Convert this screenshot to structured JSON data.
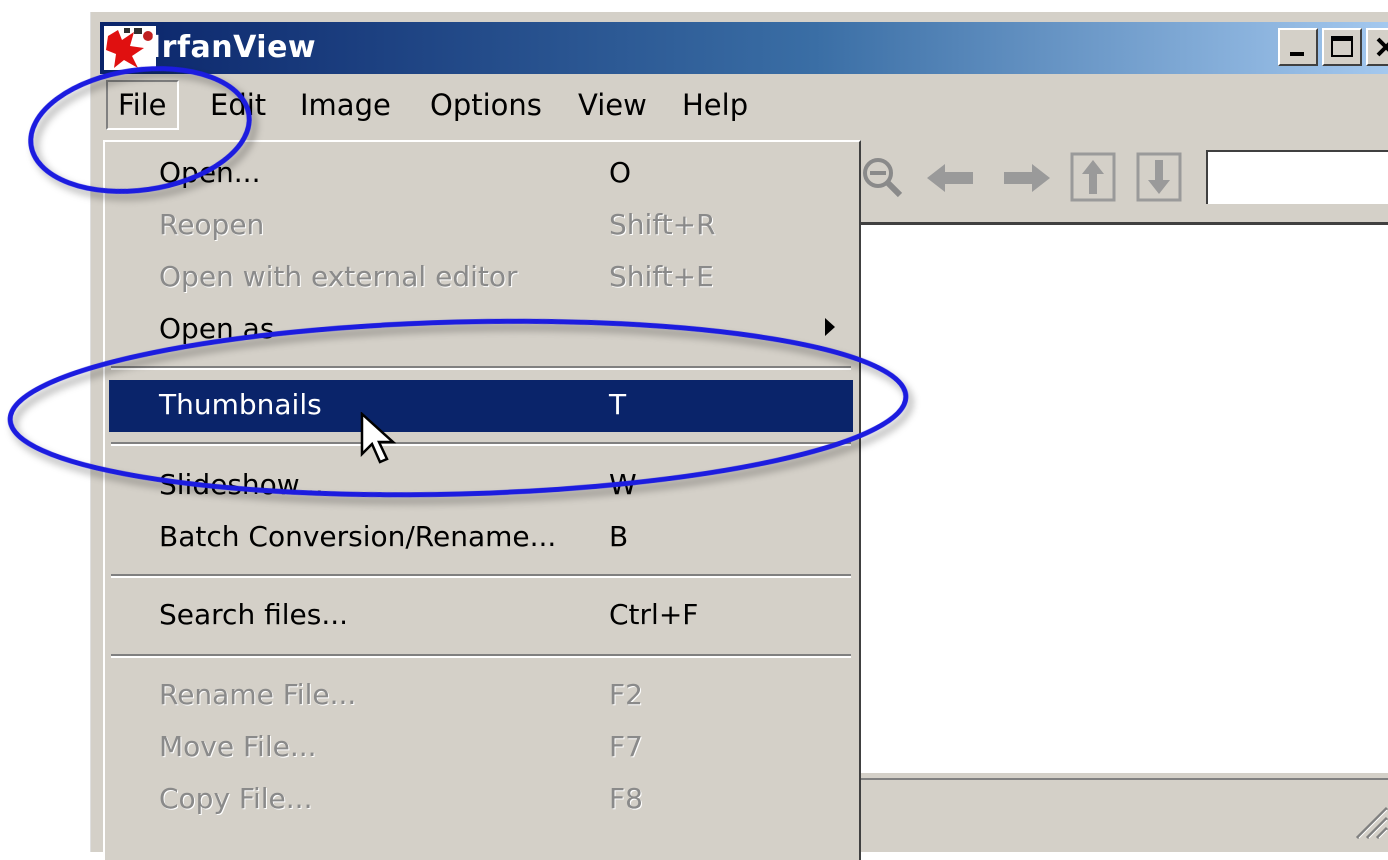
{
  "window": {
    "title": "IrfanView",
    "title_buttons": [
      "minimize",
      "maximize",
      "close"
    ]
  },
  "menubar": {
    "items": [
      "File",
      "Edit",
      "Image",
      "Options",
      "View",
      "Help"
    ]
  },
  "file_menu": {
    "items": [
      {
        "label": "Open...",
        "shortcut": "O",
        "enabled": true
      },
      {
        "label": "Reopen",
        "shortcut": "Shift+R",
        "enabled": false
      },
      {
        "label": "Open with external editor",
        "shortcut": "Shift+E",
        "enabled": false
      },
      {
        "label": "Open as",
        "shortcut": "",
        "enabled": true,
        "submenu": true
      },
      {
        "label": "Thumbnails",
        "shortcut": "T",
        "enabled": true,
        "selected": true
      },
      {
        "label": "Slideshow...",
        "shortcut": "W",
        "enabled": true
      },
      {
        "label": "Batch Conversion/Rename...",
        "shortcut": "B",
        "enabled": true
      },
      {
        "label": "Search files...",
        "shortcut": "Ctrl+F",
        "enabled": true
      },
      {
        "label": "Rename File...",
        "shortcut": "F2",
        "enabled": false
      },
      {
        "label": "Move File...",
        "shortcut": "F7",
        "enabled": false
      },
      {
        "label": "Copy File...",
        "shortcut": "F8",
        "enabled": false
      }
    ]
  },
  "toolbar": {
    "icons": [
      "zoom-out-icon",
      "arrow-left-icon",
      "arrow-right-icon",
      "arrow-up-icon",
      "arrow-down-icon"
    ]
  },
  "colors": {
    "title_start": "#0a246a",
    "title_end": "#a6caf0",
    "selection": "#0a246a",
    "face": "#d4d0c8",
    "annotation": "#1a1adf"
  }
}
